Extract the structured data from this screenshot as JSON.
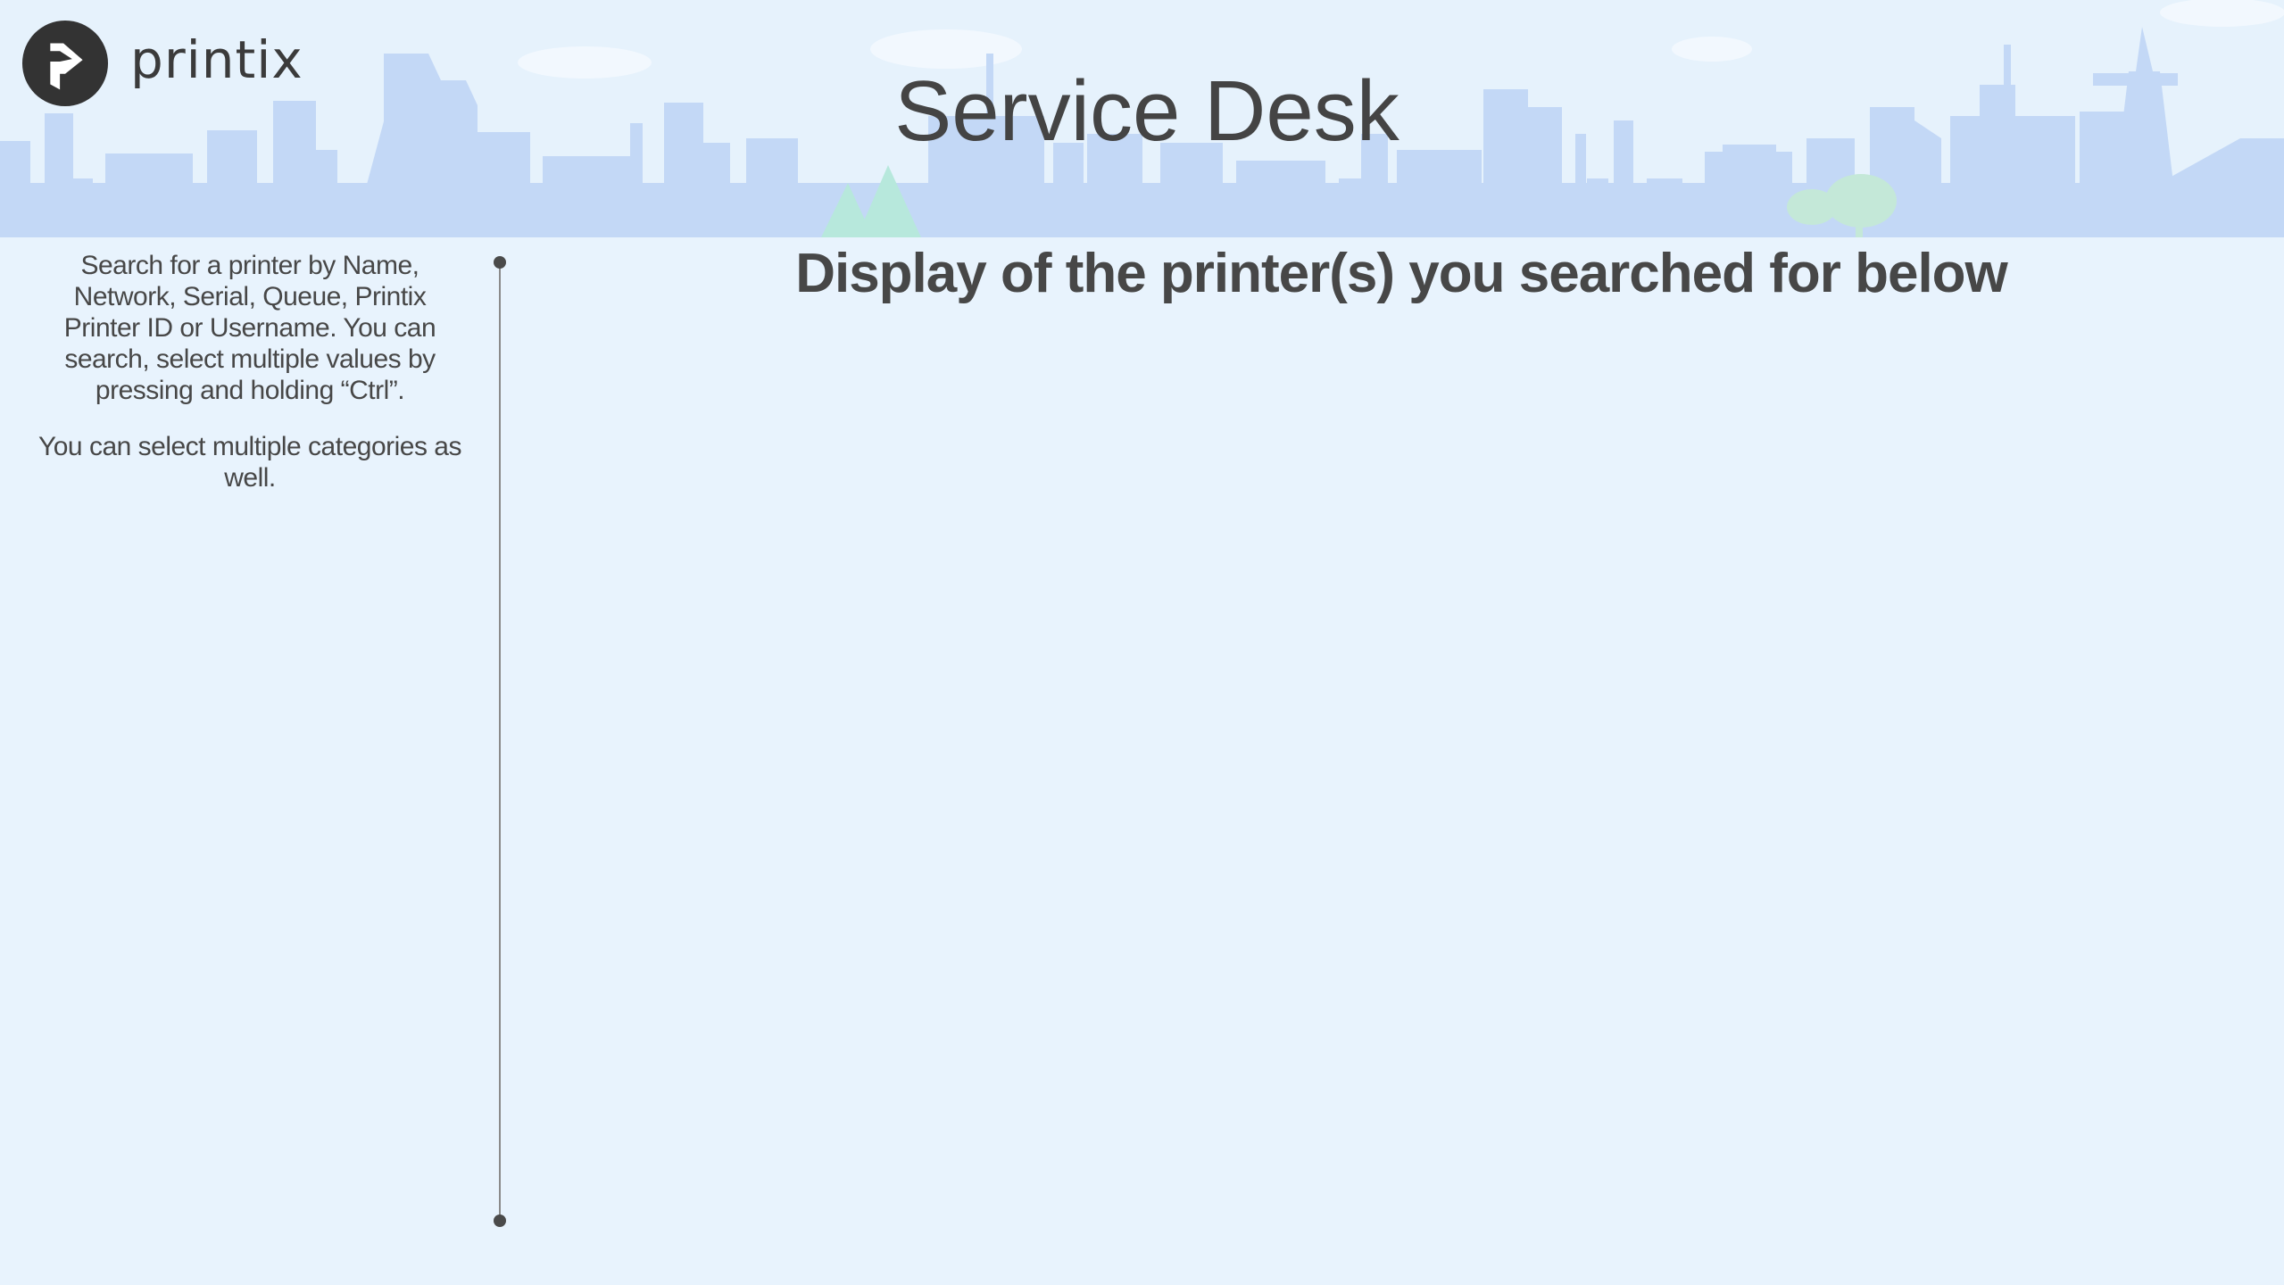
{
  "brand": {
    "logo_text": "printix",
    "logo_icon": "printix-arrow-icon"
  },
  "header": {
    "title": "Service Desk"
  },
  "help": {
    "paragraph1": "Search for a printer by Name, Network, Serial, Queue, Printix Printer ID or Username. You can search, select multiple values by pressing and holding “Ctrl”.",
    "paragraph2": "You can select multiple categories as well."
  },
  "results": {
    "heading": "Display of the printer(s) you searched for below"
  },
  "colors": {
    "background": "#e8f3fd",
    "skyline": "#c3d8f6",
    "tree": "#b9e6dc",
    "text": "#454545",
    "divider": "#8a8a8a"
  }
}
